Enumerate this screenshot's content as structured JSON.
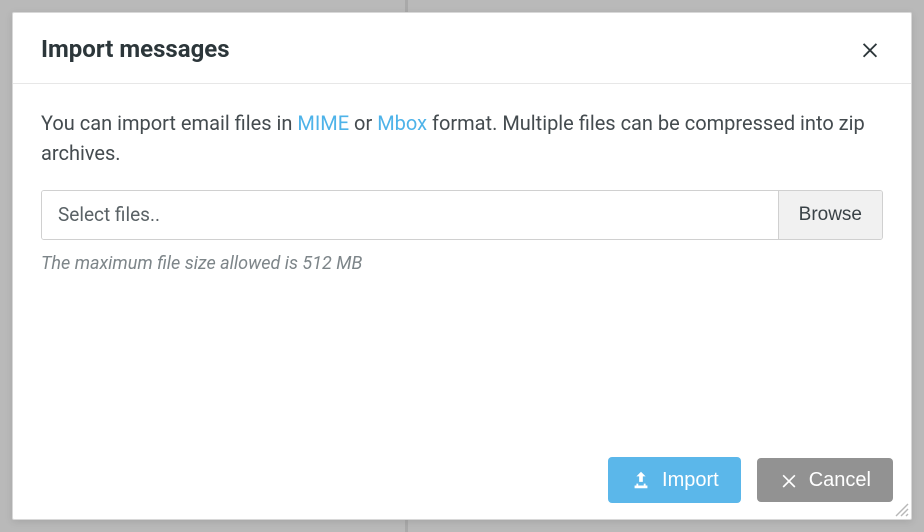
{
  "dialog": {
    "title": "Import messages",
    "description_pre": "You can import email files in ",
    "link_mime": "MIME",
    "description_or": " or ",
    "link_mbox": "Mbox",
    "description_post": " format. Multiple files can be compressed into zip archives.",
    "file_placeholder": "Select files..",
    "browse_label": "Browse",
    "hint": "The maximum file size allowed is 512 MB",
    "import_label": "Import",
    "cancel_label": "Cancel"
  }
}
